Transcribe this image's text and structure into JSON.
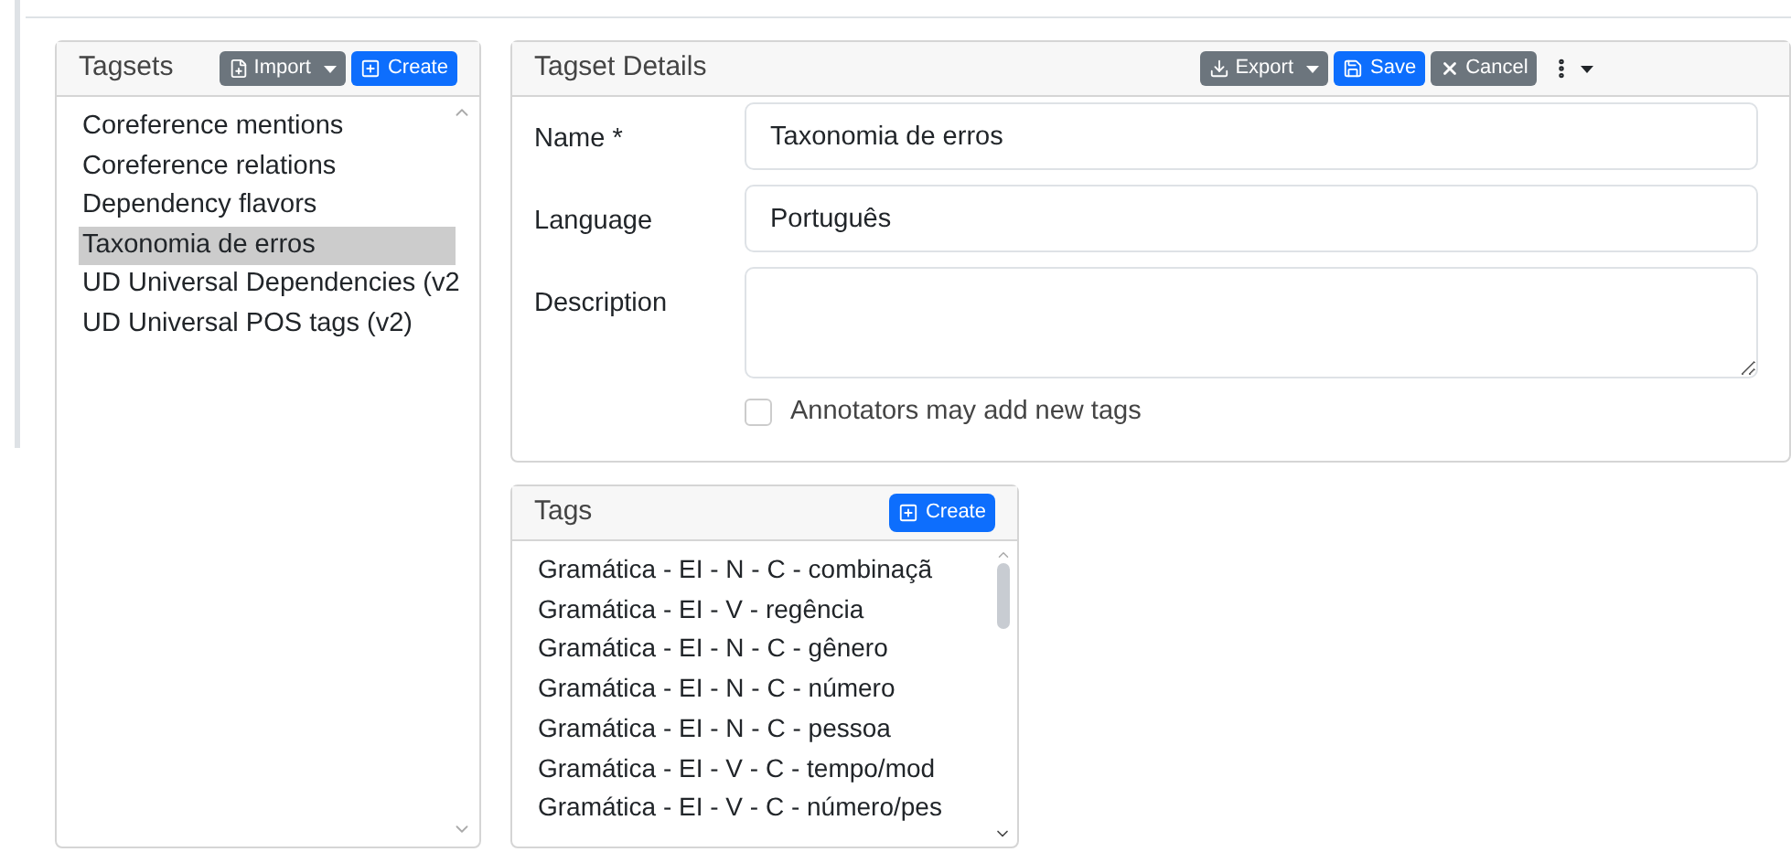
{
  "tagsets": {
    "title": "Tagsets",
    "import_button": "Import",
    "create_button": "Create",
    "items": [
      {
        "label": "Coreference mentions",
        "selected": false
      },
      {
        "label": "Coreference relations",
        "selected": false
      },
      {
        "label": "Dependency flavors",
        "selected": false
      },
      {
        "label": "Taxonomia de erros",
        "selected": true
      },
      {
        "label": "UD Universal Dependencies (v2",
        "selected": false
      },
      {
        "label": "UD Universal POS tags (v2)",
        "selected": false
      }
    ]
  },
  "details": {
    "title": "Tagset Details",
    "export_button": "Export",
    "save_button": "Save",
    "cancel_button": "Cancel",
    "fields": [
      {
        "label": "Name *",
        "value": "Taxonomia de erros",
        "kind": "input"
      },
      {
        "label": "Language",
        "value": "Português",
        "kind": "input"
      },
      {
        "label": "Description",
        "kind": "textarea"
      }
    ],
    "checkbox": {
      "label": "Annotators may add new tags",
      "checked": false
    }
  },
  "tags": {
    "title": "Tags",
    "create_button": "Create",
    "items": [
      "Gramática - EI - N - C - combinaçã",
      "Gramática - EI - V - regência",
      "Gramática - EI - N - C - gênero",
      "Gramática - EI - N - C - número",
      "Gramática - EI - N - C - pessoa",
      "Gramática - EI - V - C - tempo/mod",
      "Gramática - EI - V - C - número/pes"
    ]
  }
}
